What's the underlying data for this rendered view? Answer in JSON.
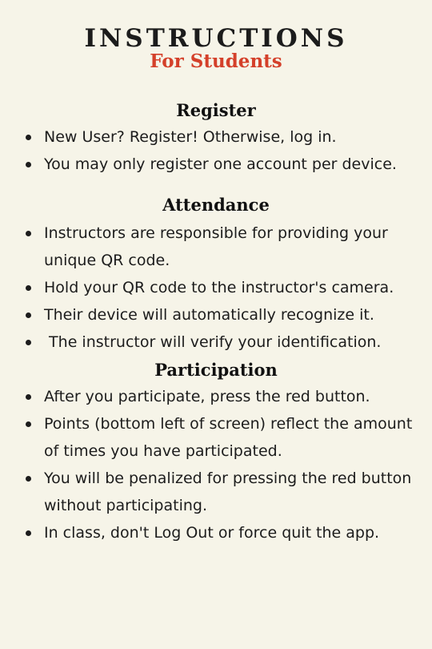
{
  "header": {
    "title": "INSTRUCTIONS",
    "subtitle": "For Students"
  },
  "sections": [
    {
      "heading": "Register",
      "items": [
        "New User? Register! Otherwise, log in.",
        "You may only register one account per device."
      ]
    },
    {
      "heading": "Attendance",
      "items": [
        "Instructors are responsible for providing your unique QR code.",
        "Hold your QR code to the instructor's camera.",
        "Their device will automatically recognize it.",
        " The instructor will verify your identification."
      ]
    },
    {
      "heading": "Participation",
      "items": [
        "After you participate, press the red button.",
        "Points (bottom left of screen) reflect the amount of times you have participated.",
        "You will be penalized for pressing the red button without participating.",
        "In class, don't Log Out or force quit the app."
      ]
    }
  ],
  "colors": {
    "background": "#f6f4e8",
    "accent": "#d4402a",
    "text": "#1c1c1c"
  }
}
